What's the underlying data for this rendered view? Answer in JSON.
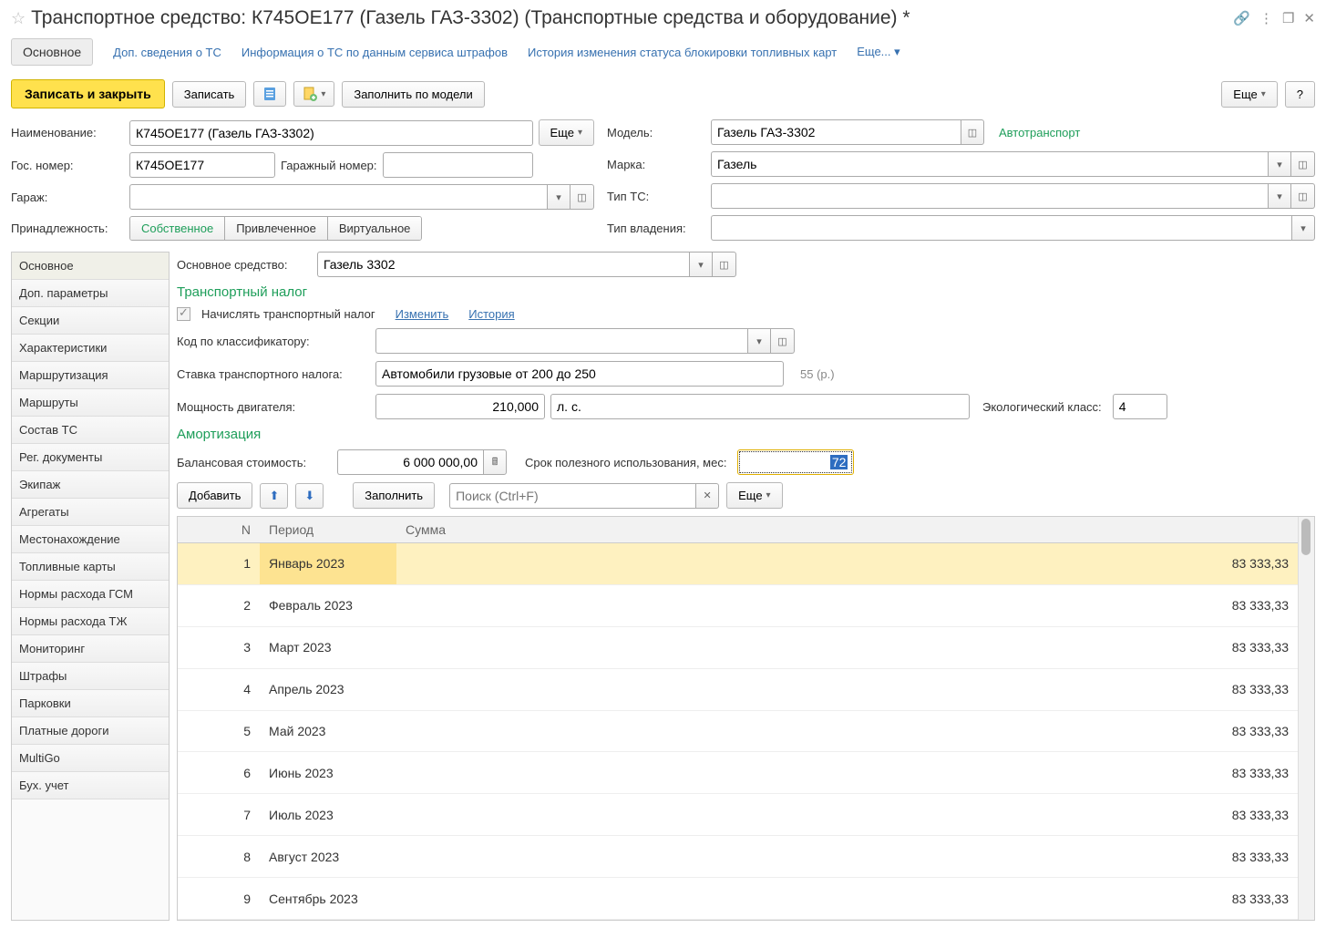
{
  "title": "Транспортное средство: К745ОЕ177 (Газель ГАЗ-3302) (Транспортные средства и оборудование) *",
  "nav": {
    "active": "Основное",
    "links": [
      "Доп. сведения о ТС",
      "Информация о ТС по данным сервиса штрафов",
      "История изменения статуса блокировки топливных карт"
    ],
    "more": "Еще..."
  },
  "toolbar": {
    "saveClose": "Записать и закрыть",
    "save": "Записать",
    "fillByModel": "Заполнить по модели",
    "more": "Еще",
    "help": "?"
  },
  "form": {
    "name_label": "Наименование:",
    "name_value": "К745ОЕ177 (Газель ГАЗ-3302)",
    "name_more": "Еще",
    "gosnum_label": "Гос. номер:",
    "gosnum_value": "К745ОЕ177",
    "garagenum_label": "Гаражный номер:",
    "garagenum_value": "",
    "garage_label": "Гараж:",
    "garage_value": "",
    "owner_label": "Принадлежность:",
    "owner_opts": [
      "Собственное",
      "Привлеченное",
      "Виртуальное"
    ],
    "model_label": "Модель:",
    "model_value": "Газель ГАЗ-3302",
    "model_type": "Автотранспорт",
    "brand_label": "Марка:",
    "brand_value": "Газель",
    "tipts_label": "Тип ТС:",
    "tipts_value": "",
    "ownt_label": "Тип владения:",
    "ownt_value": ""
  },
  "side": [
    "Основное",
    "Доп. параметры",
    "Секции",
    "Характеристики",
    "Маршрутизация",
    "Маршруты",
    "Состав ТС",
    "Рег. документы",
    "Экипаж",
    "Агрегаты",
    "Местонахождение",
    "Топливные карты",
    "Нормы расхода ГСМ",
    "Нормы расхода ТЖ",
    "Мониторинг",
    "Штрафы",
    "Парковки",
    "Платные дороги",
    "MultiGo",
    "Бух. учет"
  ],
  "main": {
    "os_label": "Основное средство:",
    "os_value": "Газель 3302",
    "tax_header": "Транспортный налог",
    "tax_chk": "Начислять транспортный налог",
    "tax_edit": "Изменить",
    "tax_hist": "История",
    "code_label": "Код по классификатору:",
    "code_value": "",
    "rate_label": "Ставка транспортного налога:",
    "rate_value": "Автомобили грузовые от 200 до 250",
    "rate_amt": "55 (р.)",
    "power_label": "Мощность двигателя:",
    "power_value": "210,000",
    "power_unit": "л. с.",
    "eco_label": "Экологический класс:",
    "eco_value": "4",
    "amort_header": "Амортизация",
    "bal_label": "Балансовая стоимость:",
    "bal_value": "6 000 000,00",
    "term_label": "Срок полезного использования, мес:",
    "term_value": "72",
    "tb": {
      "add": "Добавить",
      "fill": "Заполнить",
      "search_ph": "Поиск (Ctrl+F)",
      "more": "Еще"
    },
    "th": {
      "n": "N",
      "period": "Период",
      "sum": "Сумма"
    },
    "rows": [
      {
        "n": "1",
        "p": "Январь 2023",
        "s": "83 333,33"
      },
      {
        "n": "2",
        "p": "Февраль 2023",
        "s": "83 333,33"
      },
      {
        "n": "3",
        "p": "Март 2023",
        "s": "83 333,33"
      },
      {
        "n": "4",
        "p": "Апрель 2023",
        "s": "83 333,33"
      },
      {
        "n": "5",
        "p": "Май 2023",
        "s": "83 333,33"
      },
      {
        "n": "6",
        "p": "Июнь 2023",
        "s": "83 333,33"
      },
      {
        "n": "7",
        "p": "Июль 2023",
        "s": "83 333,33"
      },
      {
        "n": "8",
        "p": "Август 2023",
        "s": "83 333,33"
      },
      {
        "n": "9",
        "p": "Сентябрь 2023",
        "s": "83 333,33"
      }
    ]
  }
}
